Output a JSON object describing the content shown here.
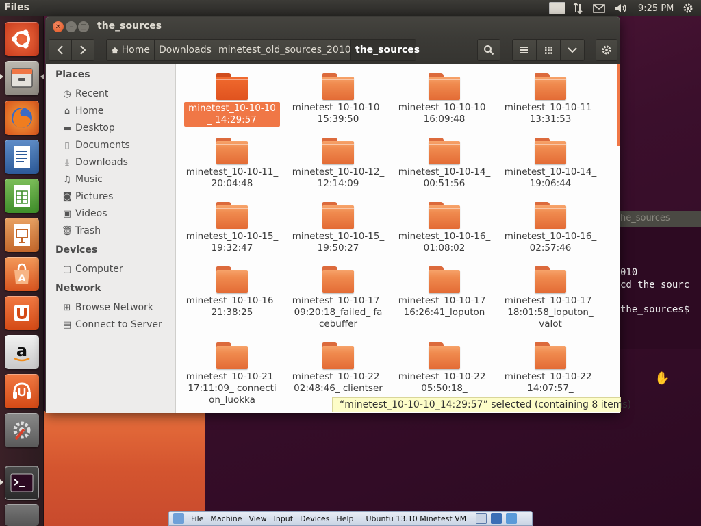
{
  "top_panel": {
    "app_name": "Files",
    "keyboard_layout": "En",
    "time": "9:25 PM",
    "icons": [
      "network-icon",
      "mail-icon",
      "volume-icon",
      "settings-gear-icon"
    ]
  },
  "launcher": {
    "items": [
      "ubuntu-dash",
      "files",
      "firefox",
      "libreoffice-writer",
      "libreoffice-calc",
      "libreoffice-impress",
      "ubuntu-software-center",
      "ubuntu-one",
      "amazon",
      "ubuntu-one-music",
      "system-settings",
      "terminal",
      "trash"
    ]
  },
  "window": {
    "title": "the_sources",
    "breadcrumbs": [
      {
        "label": "Home",
        "icon": "home-icon"
      },
      {
        "label": "Downloads"
      },
      {
        "label": "minetest_old_sources_2010"
      },
      {
        "label": "the_sources",
        "active": true
      }
    ]
  },
  "sidebar": {
    "places_heading": "Places",
    "places": [
      {
        "label": "Recent",
        "icon": "clock-icon"
      },
      {
        "label": "Home",
        "icon": "home-icon"
      },
      {
        "label": "Desktop",
        "icon": "folder-icon"
      },
      {
        "label": "Documents",
        "icon": "document-icon"
      },
      {
        "label": "Downloads",
        "icon": "download-icon"
      },
      {
        "label": "Music",
        "icon": "music-icon"
      },
      {
        "label": "Pictures",
        "icon": "camera-icon"
      },
      {
        "label": "Videos",
        "icon": "film-icon"
      },
      {
        "label": "Trash",
        "icon": "trash-icon"
      }
    ],
    "devices_heading": "Devices",
    "devices": [
      {
        "label": "Computer",
        "icon": "computer-icon"
      }
    ],
    "network_heading": "Network",
    "network": [
      {
        "label": "Browse Network",
        "icon": "network-icon"
      },
      {
        "label": "Connect to Server",
        "icon": "server-icon"
      }
    ]
  },
  "files": [
    {
      "name": "minetest_10-10-10_ 14:29:57",
      "selected": true
    },
    {
      "name": "minetest_10-10-10_ 15:39:50"
    },
    {
      "name": "minetest_10-10-10_ 16:09:48"
    },
    {
      "name": "minetest_10-10-11_ 13:31:53"
    },
    {
      "name": "minetest_10-10-11_ 20:04:48"
    },
    {
      "name": "minetest_10-10-12_ 12:14:09"
    },
    {
      "name": "minetest_10-10-14_ 00:51:56"
    },
    {
      "name": "minetest_10-10-14_ 19:06:44"
    },
    {
      "name": "minetest_10-10-15_ 19:32:47"
    },
    {
      "name": "minetest_10-10-15_ 19:50:27"
    },
    {
      "name": "minetest_10-10-16_ 01:08:02"
    },
    {
      "name": "minetest_10-10-16_ 02:57:46"
    },
    {
      "name": "minetest_10-10-16_ 21:38:25"
    },
    {
      "name": "minetest_10-10-17_ 09:20:18_failed_ facebuffer"
    },
    {
      "name": "minetest_10-10-17_ 16:26:41_loputon"
    },
    {
      "name": "minetest_10-10-17_ 18:01:58_loputon_ valot"
    },
    {
      "name": "minetest_10-10-21_ 17:11:09_ connection_luokka"
    },
    {
      "name": "minetest_10-10-22_ 02:48:46_ clientser"
    },
    {
      "name": "minetest_10-10-22_ 05:50:18_"
    },
    {
      "name": "minetest_10-10-22_ 14:07:57_"
    }
  ],
  "status": "“minetest_10-10-10_14:29:57” selected  (containing 8 items)",
  "terminal": {
    "title": "he_sources",
    "lines": [
      "010",
      " cd the_sourc",
      "the_sources$"
    ]
  },
  "vbox_bar": {
    "menus": [
      "File",
      "Machine",
      "View",
      "Input",
      "Devices",
      "Help"
    ],
    "vm_name": "Ubuntu 13.10 Minetest VM"
  },
  "colors": {
    "accent": "#f07746",
    "folder": "#e36b35",
    "panel": "#3c3b37"
  }
}
